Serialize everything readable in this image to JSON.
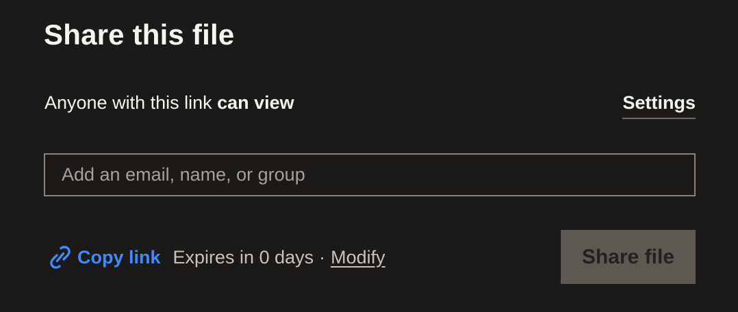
{
  "dialog": {
    "title": "Share this file"
  },
  "access": {
    "prefix": "Anyone with this link ",
    "permission": "can view",
    "settings_label": "Settings"
  },
  "recipient_input": {
    "value": "",
    "placeholder": "Add an email, name, or group"
  },
  "footer": {
    "link_icon": "link-icon",
    "copy_label": "Copy link",
    "expires_text": "Expires in 0 days",
    "separator": "·",
    "modify_label": "Modify",
    "share_button_label": "Share file"
  },
  "colors": {
    "background": "#1b1a19",
    "accent_blue": "#3d8bfd",
    "disabled_button": "#5d5852"
  }
}
